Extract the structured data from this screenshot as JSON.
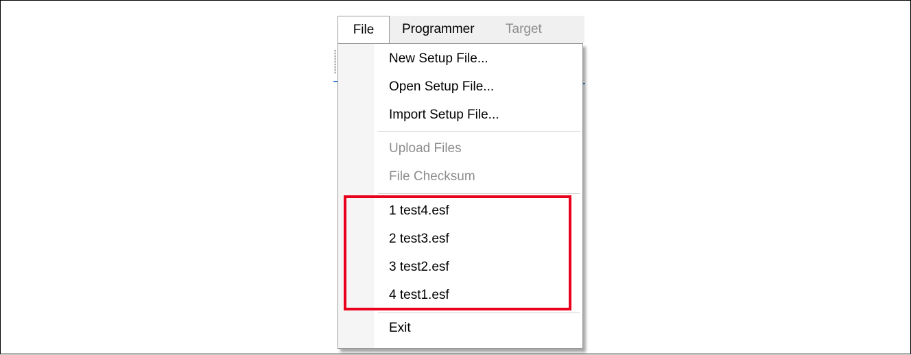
{
  "menubar": {
    "items": [
      {
        "label": "File"
      },
      {
        "label": "Programmer"
      },
      {
        "label": "Target"
      }
    ]
  },
  "file_menu": {
    "new_setup": "New Setup File...",
    "open_setup": "Open Setup File...",
    "import_setup": "Import Setup File...",
    "upload_files": "Upload Files",
    "file_checksum": "File Checksum",
    "recent_files": [
      {
        "label": "1 test4.esf"
      },
      {
        "label": "2 test3.esf"
      },
      {
        "label": "3 test2.esf"
      },
      {
        "label": "4 test1.esf"
      }
    ],
    "exit": "Exit"
  },
  "colors": {
    "highlight_border": "#e8001c",
    "disabled_text": "#8d8d8d",
    "accent_line": "#3b7fd6"
  }
}
